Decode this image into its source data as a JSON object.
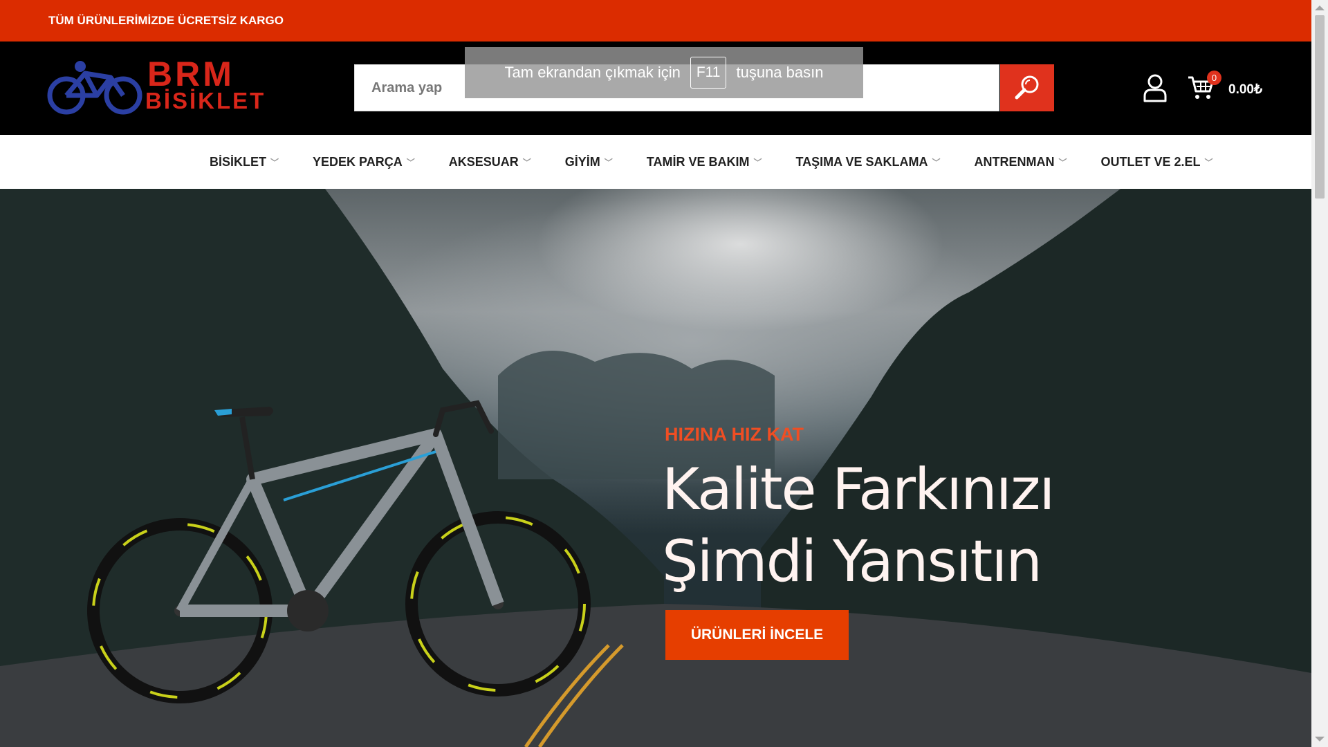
{
  "topbar": {
    "promo": "TÜM ÜRÜNLERİMİZDE ÜCRETSİZ KARGO"
  },
  "logo": {
    "line1": "BRM",
    "line2": "BİSİKLET"
  },
  "search": {
    "placeholder": "Arama yap"
  },
  "fullscreen_notice": {
    "before": "Tam ekrandan çıkmak için",
    "key": "F11",
    "after": "tuşuna basın"
  },
  "cart": {
    "count": "0",
    "total": "0.00₺"
  },
  "nav": {
    "items": [
      "BİSİKLET",
      "YEDEK PARÇA",
      "AKSESUAR",
      "GİYİM",
      "TAMİR VE BAKIM",
      "TAŞIMA VE SAKLAMA",
      "ANTRENMAN",
      "OUTLET VE 2.EL"
    ]
  },
  "hero": {
    "kicker": "HIZINA HIZ KAT",
    "headline_line1": "Kalite Farkınızı",
    "headline_line2": "Şimdi Yansıtın",
    "cta": "ÜRÜNLERİ İNCELE"
  },
  "icons": {
    "search": "search-icon",
    "user": "user-icon",
    "cart": "cart-icon",
    "chevron": "chevron-down-icon"
  },
  "colors": {
    "topbar": "#db2c00",
    "accent": "#e0321d",
    "cta": "#e63e00",
    "kicker": "#f04e23",
    "logo_blue": "#2b3fa3"
  }
}
